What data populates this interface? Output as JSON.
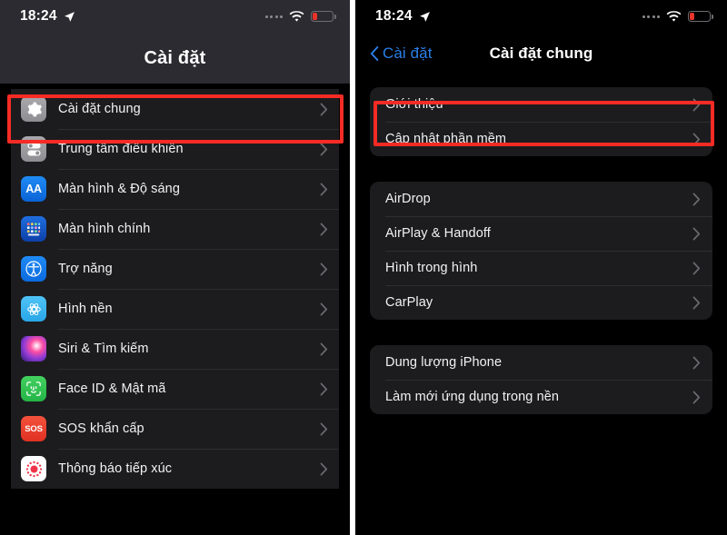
{
  "status_bar": {
    "time": "18:24",
    "location_icon": "location-arrow-icon",
    "signal_icon": "signal-dots-icon",
    "wifi_icon": "wifi-icon",
    "battery_icon": "battery-low-icon",
    "battery_color": "#e8342b"
  },
  "colors": {
    "highlight": "#f62b25",
    "accent_link": "#2a7fe8",
    "row_background": "#1c1c1e",
    "screen_background": "#000000",
    "left_header_background": "#2b2b31",
    "separator": "#2e2e31",
    "text_primary": "#f2f2f4"
  },
  "left_screen": {
    "header_title": "Cài đặt",
    "highlighted_row_index": 0,
    "items": [
      {
        "label": "Cài đặt chung",
        "icon": "gear-icon",
        "icon_class": "ic-gear"
      },
      {
        "label": "Trung tâm điều khiển",
        "icon": "control-center-icon",
        "icon_class": "ic-cc"
      },
      {
        "label": "Màn hình & Độ sáng",
        "icon": "display-brightness-icon",
        "icon_class": "ic-aa"
      },
      {
        "label": "Màn hình chính",
        "icon": "home-screen-icon",
        "icon_class": "ic-home"
      },
      {
        "label": "Trợ năng",
        "icon": "accessibility-icon",
        "icon_class": "ic-acc"
      },
      {
        "label": "Hình nền",
        "icon": "wallpaper-icon",
        "icon_class": "ic-wall"
      },
      {
        "label": "Siri & Tìm kiếm",
        "icon": "siri-icon",
        "icon_class": "ic-siri"
      },
      {
        "label": "Face ID & Mật mã",
        "icon": "face-id-icon",
        "icon_class": "ic-face"
      },
      {
        "label": "SOS khẩn cấp",
        "icon": "sos-icon",
        "icon_class": "ic-sos"
      },
      {
        "label": "Thông báo tiếp xúc",
        "icon": "exposure-notification-icon",
        "icon_class": "ic-exp"
      }
    ]
  },
  "right_screen": {
    "back_label": "Cài đặt",
    "back_icon": "chevron-left-icon",
    "title": "Cài đặt chung",
    "highlighted_row": "Giới thiệu",
    "groups": [
      {
        "items": [
          {
            "label": "Giới thiệu"
          },
          {
            "label": "Cập nhật phần mềm"
          }
        ]
      },
      {
        "items": [
          {
            "label": "AirDrop"
          },
          {
            "label": "AirPlay & Handoff"
          },
          {
            "label": "Hình trong hình"
          },
          {
            "label": "CarPlay"
          }
        ]
      },
      {
        "items": [
          {
            "label": "Dung lượng iPhone"
          },
          {
            "label": "Làm mới ứng dụng trong nền"
          }
        ]
      }
    ]
  }
}
